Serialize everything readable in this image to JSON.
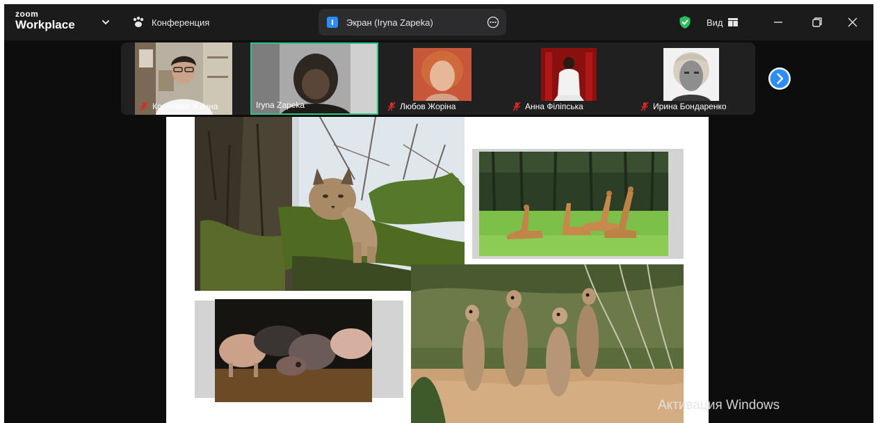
{
  "titlebar": {
    "logo_top": "zoom",
    "logo_bottom": "Workplace",
    "meeting_label": "Конференция",
    "share_label": "Экран (Iryna Zapeka)",
    "view_label": "Вид"
  },
  "participants": [
    {
      "name": "Коренева Жанна",
      "muted": true,
      "active": false
    },
    {
      "name": "Iryna Zapeka",
      "muted": false,
      "active": true
    },
    {
      "name": "Любов Жоріна",
      "muted": true,
      "active": false
    },
    {
      "name": "Анна Філіпська",
      "muted": true,
      "active": false
    },
    {
      "name": "Ирина Бондаренко",
      "muted": true,
      "active": false
    }
  ],
  "colors": {
    "active_speaker_border": "#27c787",
    "accent_blue": "#2d8cff",
    "mute_red": "#e02828",
    "shield_green": "#2dbe5c"
  },
  "watermark": "Активация Windows",
  "icons": [
    "chevron-down-icon",
    "paw-icon",
    "share-indicator-icon",
    "more-icon",
    "shield-icon",
    "view-grid-icon",
    "minimize-icon",
    "maximize-icon",
    "close-icon",
    "mic-muted-icon",
    "next-icon"
  ]
}
